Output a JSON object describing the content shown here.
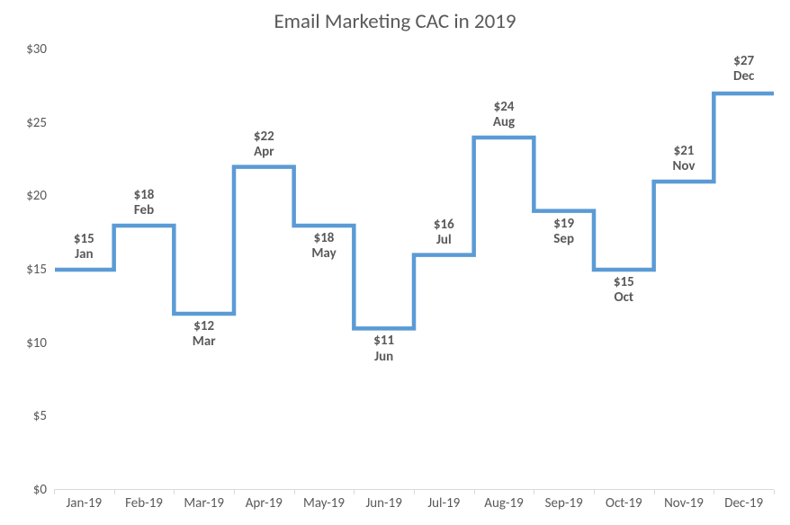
{
  "chart_data": {
    "type": "line",
    "title": "Email Marketing CAC in 2019",
    "xlabel": "",
    "ylabel": "",
    "ylim": [
      0,
      30
    ],
    "categories": [
      "Jan-19",
      "Feb-19",
      "Mar-19",
      "Apr-19",
      "May-19",
      "Jun-19",
      "Jul-19",
      "Aug-19",
      "Sep-19",
      "Oct-19",
      "Nov-19",
      "Dec-19"
    ],
    "short_months": [
      "Jan",
      "Feb",
      "Mar",
      "Apr",
      "May",
      "Jun",
      "Jul",
      "Aug",
      "Sep",
      "Oct",
      "Nov",
      "Dec"
    ],
    "values": [
      15,
      18,
      12,
      22,
      18,
      11,
      16,
      24,
      19,
      15,
      21,
      27
    ],
    "value_labels": [
      "$15",
      "$18",
      "$12",
      "$22",
      "$18",
      "$11",
      "$16",
      "$24",
      "$19",
      "$15",
      "$21",
      "$27"
    ],
    "label_position": [
      "above",
      "above",
      "below",
      "above",
      "below",
      "below",
      "above",
      "above",
      "below",
      "below",
      "above",
      "above"
    ],
    "y_ticks": [
      0,
      5,
      10,
      15,
      20,
      25,
      30
    ],
    "y_tick_labels": [
      "$0",
      "$5",
      "$10",
      "$15",
      "$20",
      "$25",
      "$30"
    ]
  }
}
